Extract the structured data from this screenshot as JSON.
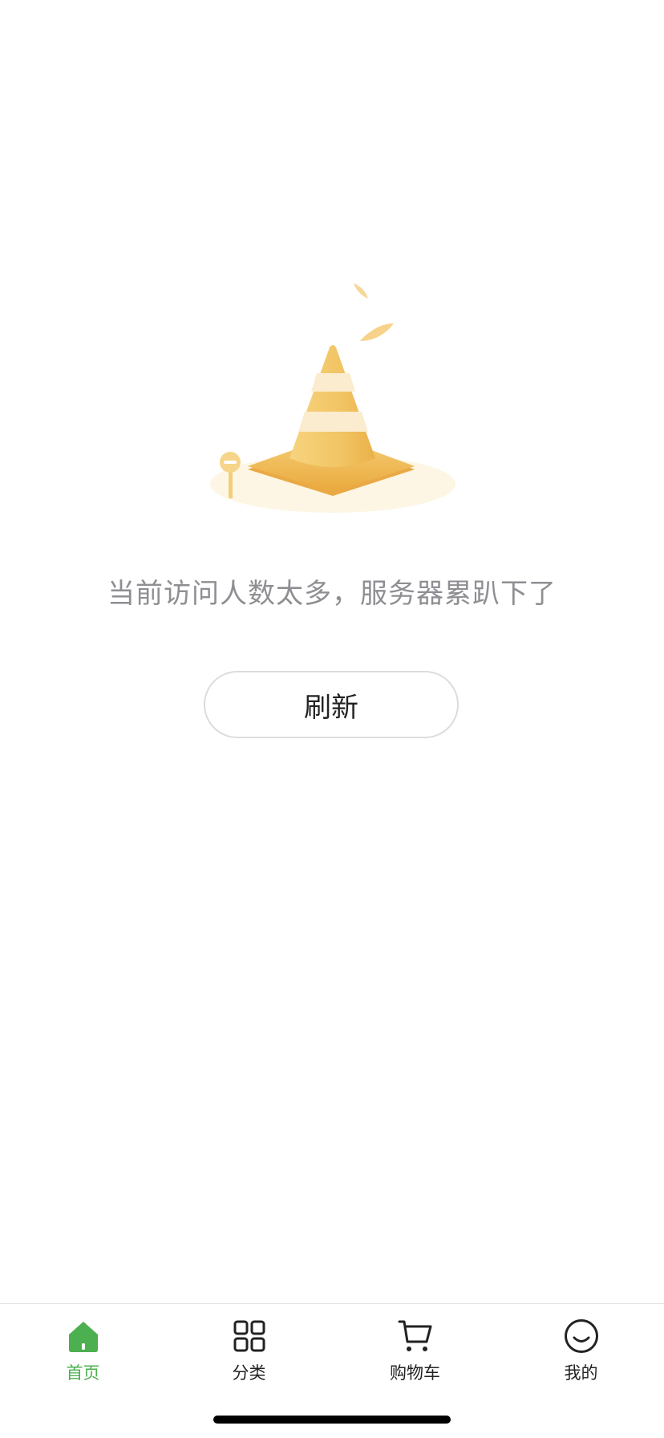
{
  "error": {
    "message": "当前访问人数太多，服务器累趴下了",
    "illustration": "traffic-cone-illustration"
  },
  "actions": {
    "refresh_label": "刷新"
  },
  "tabbar": {
    "items": [
      {
        "label": "首页",
        "icon": "home-icon",
        "active": true
      },
      {
        "label": "分类",
        "icon": "grid-icon",
        "active": false
      },
      {
        "label": "购物车",
        "icon": "cart-icon",
        "active": false
      },
      {
        "label": "我的",
        "icon": "smiley-icon",
        "active": false
      }
    ]
  },
  "colors": {
    "accent": "#4cb050",
    "text_secondary": "#8e8e93",
    "text_primary": "#222222",
    "cone": "#f2c463",
    "cone_stripe": "#fbeccf"
  }
}
